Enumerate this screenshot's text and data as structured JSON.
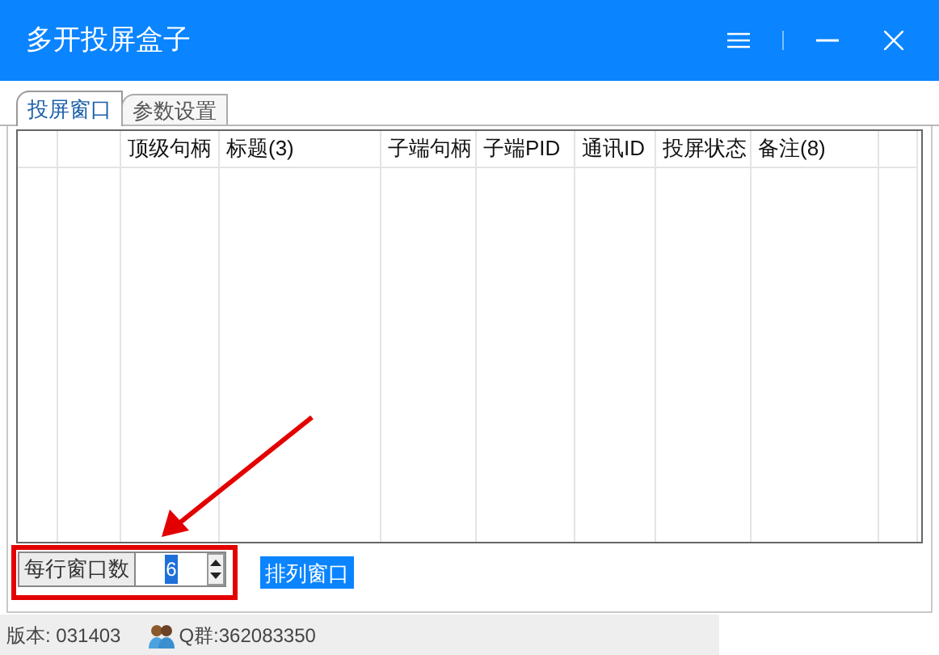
{
  "window": {
    "title": "多开投屏盒子"
  },
  "tabs": [
    {
      "label": "投屏窗口",
      "selected": true
    },
    {
      "label": "参数设置",
      "selected": false
    }
  ],
  "table": {
    "columns": [
      "",
      "",
      "顶级句柄",
      "标题(3)",
      "子端句柄",
      "子端PID",
      "通讯ID",
      "投屏状态",
      "备注(8)",
      ""
    ]
  },
  "controls": {
    "per_row_label": "每行窗口数",
    "per_row_value": "6",
    "arrange_button": "排列窗口"
  },
  "status_bar": {
    "version": "版本: 031403",
    "qq_group": "Q群:362083350"
  }
}
